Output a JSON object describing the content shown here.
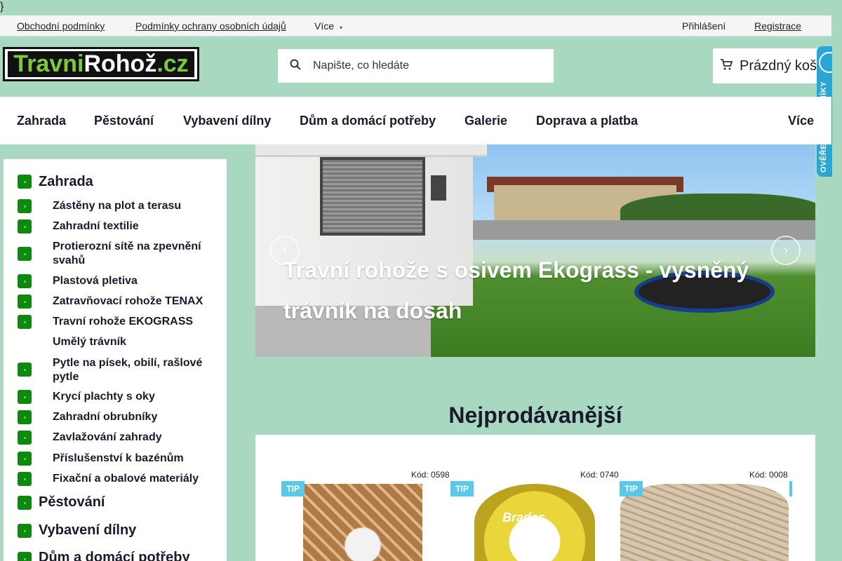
{
  "stray_char": "}",
  "topbar": {
    "links": [
      "Obchodní podmínky",
      "Podmínky ochrany osobních údajů",
      "Více"
    ],
    "login": "Přihlášení",
    "register": "Registrace"
  },
  "logo": {
    "part1": "Travni",
    "part2": "Rohož",
    "part3": ".cz"
  },
  "search": {
    "placeholder": "Napište, co hledáte"
  },
  "cart": {
    "label": "Prázdný košík"
  },
  "badge": {
    "text": "OVĚŘENO ZÁKAZNÍKY"
  },
  "mainnav": {
    "items": [
      "Zahrada",
      "Pěstování",
      "Vybavení dílny",
      "Dům a domácí potřeby",
      "Galerie",
      "Doprava a platba",
      "Více"
    ]
  },
  "sidebar": {
    "top": [
      "Zahrada",
      "Pěstování",
      "Vybavení dílny",
      "Dům a domácí potřeby"
    ],
    "sub": [
      "Zástěny na plot a terasu",
      "Zahradní textilie",
      "Protierozní sítě na zpevnění svahů",
      "Plastová pletiva",
      "Zatravňovací rohože TENAX",
      "Travní rohože EKOGRASS",
      "Umělý trávník",
      "Pytle na písek, obilí, rašlové pytle",
      "Krycí plachty s oky",
      "Zahradní obrubníky",
      "Zavlažování zahrady",
      "Příslušenství k bazénům",
      "Fixační a obalové materiály"
    ]
  },
  "hero": {
    "title": "Travní rohože s osivem Ekograss - vysněný trávník na dosah"
  },
  "bestsellers": {
    "title": "Nejprodávanější",
    "codes": [
      "Kód: 0598",
      "Kód: 0740",
      "Kód: 0008"
    ],
    "tip": "TIP",
    "hose_brand": "Bradas"
  },
  "colors": {
    "bg": "#a8d8c0",
    "bullet": "#0d8a0d",
    "tip": "#5bc8e8",
    "badge": "#2aa6d6"
  }
}
